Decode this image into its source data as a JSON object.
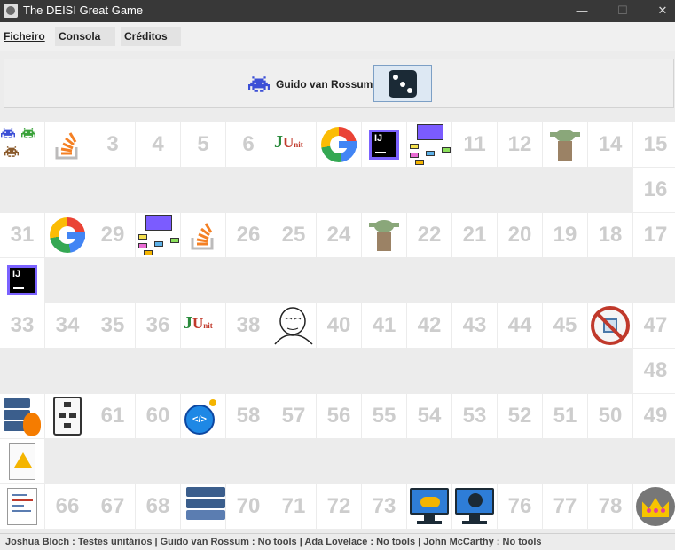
{
  "window": {
    "title": "The DEISI Great Game",
    "minimize_glyph": "—",
    "maximize_glyph": "☐",
    "close_glyph": "✕"
  },
  "menu": {
    "items": [
      "Ficheiro",
      "Consola",
      "Créditos"
    ]
  },
  "player": {
    "current_name": "Guido van Rossum",
    "icon": "purple-invader-icon",
    "dice_icon": "dice-three-icon"
  },
  "board": {
    "rows": [
      [
        {
          "label": "",
          "icon": "players-group-icon"
        },
        {
          "label": "",
          "icon": "stackoverflow-icon"
        },
        {
          "label": "3"
        },
        {
          "label": "4"
        },
        {
          "label": "5"
        },
        {
          "label": "6"
        },
        {
          "label": "",
          "icon": "junit-icon"
        },
        {
          "label": "",
          "icon": "google-icon"
        },
        {
          "label": "",
          "icon": "intellij-icon"
        },
        {
          "label": "",
          "icon": "diagram-icon"
        },
        {
          "label": "11"
        },
        {
          "label": "12"
        },
        {
          "label": "",
          "icon": "yoda-icon"
        },
        {
          "label": "14"
        },
        {
          "label": "15"
        }
      ],
      [
        {
          "label": "16"
        }
      ],
      [
        {
          "label": "31"
        },
        {
          "label": "",
          "icon": "google-icon"
        },
        {
          "label": "29"
        },
        {
          "label": "",
          "icon": "diagram-icon"
        },
        {
          "label": "",
          "icon": "stackoverflow-icon"
        },
        {
          "label": "26"
        },
        {
          "label": "25"
        },
        {
          "label": "24"
        },
        {
          "label": "",
          "icon": "yoda-icon"
        },
        {
          "label": "22"
        },
        {
          "label": "21"
        },
        {
          "label": "20"
        },
        {
          "label": "19"
        },
        {
          "label": "18"
        },
        {
          "label": "17"
        }
      ],
      [
        {
          "label": "",
          "icon": "intellij-icon"
        }
      ],
      [
        {
          "label": "33"
        },
        {
          "label": "34"
        },
        {
          "label": "35"
        },
        {
          "label": "36"
        },
        {
          "label": "",
          "icon": "junit-icon"
        },
        {
          "label": "38"
        },
        {
          "label": "",
          "icon": "meme-face-icon"
        },
        {
          "label": "40"
        },
        {
          "label": "41"
        },
        {
          "label": "42"
        },
        {
          "label": "43"
        },
        {
          "label": "44"
        },
        {
          "label": "45"
        },
        {
          "label": "",
          "icon": "no-copy-paste-icon"
        },
        {
          "label": "47"
        }
      ],
      [
        {
          "label": "48"
        }
      ],
      [
        {
          "label": "",
          "icon": "server-fire-icon"
        },
        {
          "label": "",
          "icon": "flowchart-icon"
        },
        {
          "label": "61"
        },
        {
          "label": "60"
        },
        {
          "label": "",
          "icon": "code-bomb-icon"
        },
        {
          "label": "58"
        },
        {
          "label": "57"
        },
        {
          "label": "56"
        },
        {
          "label": "55"
        },
        {
          "label": "54"
        },
        {
          "label": "53"
        },
        {
          "label": "52"
        },
        {
          "label": "51"
        },
        {
          "label": "50"
        },
        {
          "label": "49"
        }
      ],
      [
        {
          "label": "",
          "icon": "warning-document-icon"
        }
      ],
      [
        {
          "label": "",
          "icon": "syntax-error-icon"
        },
        {
          "label": "66"
        },
        {
          "label": "67"
        },
        {
          "label": "68"
        },
        {
          "label": "",
          "icon": "server-rack-icon"
        },
        {
          "label": "70"
        },
        {
          "label": "71"
        },
        {
          "label": "72"
        },
        {
          "label": "73"
        },
        {
          "label": "",
          "icon": "cloud-monitor-icon"
        },
        {
          "label": "",
          "icon": "skull-monitor-icon"
        },
        {
          "label": "76"
        },
        {
          "label": "77"
        },
        {
          "label": "78"
        },
        {
          "label": "",
          "icon": "crown-icon"
        }
      ]
    ]
  },
  "status": {
    "text": "Joshua Bloch : Testes unitários | Guido van Rossum : No tools | Ada Lovelace : No tools | John McCarthy : No tools"
  },
  "colors": {
    "titlebar": "#383838",
    "cell_bg": "#ffffff",
    "cell_number": "#cdcdcd",
    "board_bg": "#ececec"
  }
}
